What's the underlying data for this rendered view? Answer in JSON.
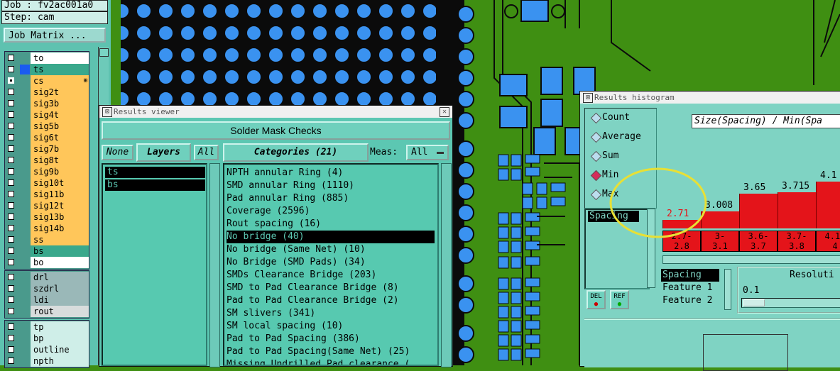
{
  "left_panel": {
    "job_label": "Job : fv2ac001a0",
    "step_label": "Step: cam",
    "job_matrix_button": "Job Matrix ...",
    "layer_groups": [
      {
        "layers": [
          {
            "name": "to",
            "checked": false,
            "color": "",
            "bg": "#ffffff"
          },
          {
            "name": "ts",
            "checked": false,
            "color": "#1a5cf0",
            "bg": "#3aa88c"
          },
          {
            "name": "cs",
            "checked": true,
            "color": "",
            "bg": "#ffc65a",
            "marker": "⊞"
          },
          {
            "name": "sig2t",
            "checked": false,
            "color": "",
            "bg": "#ffc65a"
          },
          {
            "name": "sig3b",
            "checked": false,
            "color": "",
            "bg": "#ffc65a"
          },
          {
            "name": "sig4t",
            "checked": false,
            "color": "",
            "bg": "#ffc65a"
          },
          {
            "name": "sig5b",
            "checked": false,
            "color": "",
            "bg": "#ffc65a"
          },
          {
            "name": "sig6t",
            "checked": false,
            "color": "",
            "bg": "#ffc65a"
          },
          {
            "name": "sig7b",
            "checked": false,
            "color": "",
            "bg": "#ffc65a"
          },
          {
            "name": "sig8t",
            "checked": false,
            "color": "",
            "bg": "#ffc65a"
          },
          {
            "name": "sig9b",
            "checked": false,
            "color": "",
            "bg": "#ffc65a"
          },
          {
            "name": "sig10t",
            "checked": false,
            "color": "",
            "bg": "#ffc65a"
          },
          {
            "name": "sig11b",
            "checked": false,
            "color": "",
            "bg": "#ffc65a"
          },
          {
            "name": "sig12t",
            "checked": false,
            "color": "",
            "bg": "#ffc65a"
          },
          {
            "name": "sig13b",
            "checked": false,
            "color": "",
            "bg": "#ffc65a"
          },
          {
            "name": "sig14b",
            "checked": false,
            "color": "",
            "bg": "#ffc65a"
          },
          {
            "name": "ss",
            "checked": false,
            "color": "",
            "bg": "#ffc65a"
          },
          {
            "name": "bs",
            "checked": false,
            "color": "",
            "bg": "#3aa88c"
          },
          {
            "name": "bo",
            "checked": false,
            "color": "",
            "bg": "#ffffff"
          }
        ]
      },
      {
        "layers": [
          {
            "name": "drl",
            "checked": false,
            "color": "",
            "bg": "#9ab8b8"
          },
          {
            "name": "szdrl",
            "checked": false,
            "color": "",
            "bg": "#9ab8b8"
          },
          {
            "name": "ldi",
            "checked": false,
            "color": "",
            "bg": "#9ab8b8"
          },
          {
            "name": "rout",
            "checked": false,
            "color": "",
            "bg": "#d8dcdc"
          }
        ]
      },
      {
        "layers": [
          {
            "name": "tp",
            "checked": false,
            "color": "",
            "bg": "#cfeee8"
          },
          {
            "name": "bp",
            "checked": false,
            "color": "",
            "bg": "#cfeee8"
          },
          {
            "name": "outline",
            "checked": false,
            "color": "",
            "bg": "#cfeee8"
          },
          {
            "name": "npth",
            "checked": false,
            "color": "",
            "bg": "#cfeee8"
          }
        ]
      }
    ]
  },
  "results_viewer": {
    "title": "Results viewer",
    "header_button": "Solder Mask Checks",
    "none_button": "None",
    "layers_button": "Layers",
    "all_button": "All",
    "layers": [
      "ts",
      "bs"
    ],
    "categories_button": "Categories (21)",
    "meas_label": "Meas:",
    "meas_value": "All",
    "categories": [
      "NPTH annular Ring (4)",
      "SMD annular Ring (1110)",
      "Pad annular Ring (885)",
      "Coverage (2596)",
      "Rout spacing (16)",
      "No bridge (40)",
      "No bridge (Same Net) (10)",
      "No Bridge (SMD Pads) (34)",
      "SMDs Clearance Bridge (203)",
      "SMD to Pad Clearance Bridge (8)",
      "Pad to Pad Clearance Bridge (2)",
      "SM slivers (341)",
      "SM local spacing (10)",
      "Pad to Pad Spacing (386)",
      "Pad to Pad Spacing(Same Net) (25)",
      "Missing Undrilled Pad clearance ("
    ],
    "selected_category": 5
  },
  "histogram": {
    "title": "Results histogram",
    "modes": [
      {
        "label": "Count",
        "selected": false
      },
      {
        "label": "Average",
        "selected": false
      },
      {
        "label": "Sum",
        "selected": false
      },
      {
        "label": "Min",
        "selected": true
      },
      {
        "label": "Max",
        "selected": false
      }
    ],
    "plot_title": "Size(Spacing) / Min(Spa",
    "measure_list": [
      "Spacing"
    ],
    "del_button": "DEL",
    "ref_button": "REF",
    "attributes": [
      "Spacing",
      "Feature 1",
      "Feature 2"
    ],
    "resolution_label": "Resoluti",
    "resolution_value": "0.1",
    "highlight_color": "#e4141a",
    "annotation_color": "#e8e035"
  },
  "chart_data": {
    "type": "bar",
    "title": "Size(Spacing) / Min(Spa",
    "categories": [
      "2.7-2.8",
      "3-3.1",
      "3.6-3.7",
      "3.7-3.8",
      "4.1-4"
    ],
    "category_labels": [
      [
        "2.7-",
        "2.8"
      ],
      [
        "3-",
        "3.1"
      ],
      [
        "3.6-",
        "3.7"
      ],
      [
        "3.7-",
        "3.8"
      ],
      [
        "4.1-",
        "4"
      ]
    ],
    "values": [
      2.71,
      3.008,
      3.65,
      3.715,
      4.1
    ],
    "value_labels": [
      "2.71",
      "3.008",
      "3.65",
      "3.715",
      "4.1"
    ],
    "ylim": [
      2.4,
      4.2
    ]
  }
}
